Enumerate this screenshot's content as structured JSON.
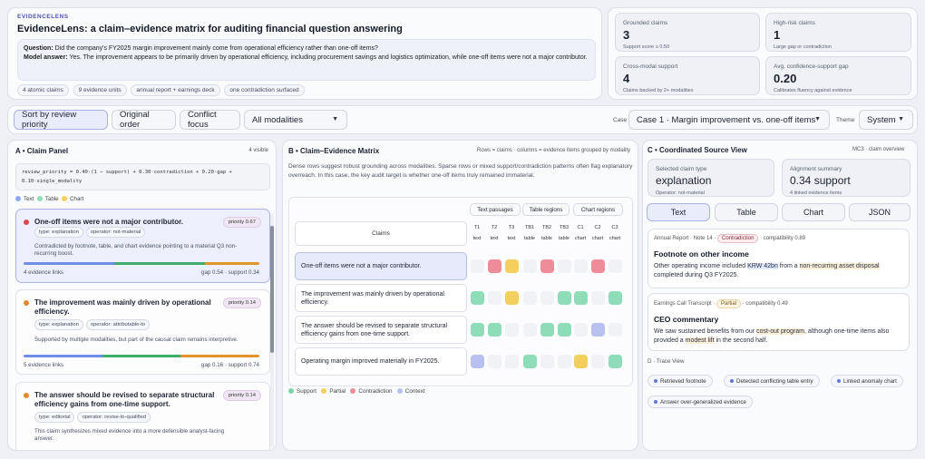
{
  "brand": "EVIDENCELENS",
  "page_title": "EvidenceLens: a claim–evidence matrix for auditing financial question answering",
  "question_label": "Question:",
  "question": "Did the company's FY2025 margin improvement mainly come from operational efficiency rather than one-off items?",
  "answer_label": "Model answer:",
  "answer": "Yes. The improvement appears to be primarily driven by operational efficiency, including procurement savings and logistics optimization, while one-off items were not a major contributor.",
  "summary_pills": [
    "4 atomic claims",
    "9 evidence units",
    "annual report + earnings deck",
    "one contradiction surfaced"
  ],
  "stats": [
    {
      "label": "Grounded claims",
      "value": "3",
      "sub": "Support score ≥ 0.50"
    },
    {
      "label": "High-risk claims",
      "value": "1",
      "sub": "Large gap or contradiction"
    },
    {
      "label": "Cross-modal support",
      "value": "4",
      "sub": "Claims backed by 2+ modalities"
    },
    {
      "label": "Avg. confidence-support gap",
      "value": "0.20",
      "sub": "Calibrates fluency against evidence"
    }
  ],
  "toolbar": {
    "sort_review": "Sort by review priority",
    "original_order": "Original order",
    "conflict_focus": "Conflict focus",
    "modalities": "All modalities",
    "case_label": "Case",
    "case_value": "Case 1 · Margin improvement vs. one-off items",
    "theme_label": "Theme",
    "theme_value": "System"
  },
  "panel_a": {
    "title": "A • Claim Panel",
    "visible": "4 visible",
    "formula_line1": "review_priority = 0.40·(1 − support) + 0.30·contradiction + 0.20·gap +",
    "formula_line2": "0.10·single_modality",
    "legend": [
      "Text",
      "Table",
      "Chart"
    ],
    "claims": [
      {
        "title": "One-off items were not a major contributor.",
        "priority": "priority 0.67",
        "type": "type: explanation",
        "operator": "operator: not-material",
        "desc": "Contradicted by footnote, table, and chart evidence pointing to a material Q3 non-recurring boost.",
        "links": "4 evidence links",
        "metrics": "gap 0.54 · support 0.34"
      },
      {
        "title": "The improvement was mainly driven by operational efficiency.",
        "priority": "priority 0.14",
        "type": "type: explanation",
        "operator": "operator: attributable-to",
        "desc": "Supported by multiple modalities, but part of the causal claim remains interpretive.",
        "links": "5 evidence links",
        "metrics": "gap 0.16 · support 0.74"
      },
      {
        "title": "The answer should be revised to separate structural efficiency gains from one-time support.",
        "priority": "priority 0.14",
        "type": "type: editorial",
        "operator": "operator: revise-to-qualified",
        "desc": "This claim synthesizes mixed evidence into a more defensible analyst-facing answer."
      }
    ]
  },
  "panel_b": {
    "title": "B • Claim–Evidence Matrix",
    "note": "Rows = claims · columns = evidence items grouped by modality",
    "desc": "Dense rows suggest robust grounding across modalities. Sparse rows or mixed support/contradiction patterns often flag explanatory overreach. In this case, the key audit target is whether one-off items truly remained immaterial.",
    "groups": [
      "Text passages",
      "Table regions",
      "Chart regions"
    ],
    "claims_header": "Claims",
    "columns": [
      {
        "id": "T1",
        "kind": "text"
      },
      {
        "id": "T2",
        "kind": "text"
      },
      {
        "id": "T3",
        "kind": "text"
      },
      {
        "id": "TB1",
        "kind": "table"
      },
      {
        "id": "TB2",
        "kind": "table"
      },
      {
        "id": "TB3",
        "kind": "table"
      },
      {
        "id": "C1",
        "kind": "chart"
      },
      {
        "id": "C2",
        "kind": "chart"
      },
      {
        "id": "C3",
        "kind": "chart"
      }
    ],
    "rows": [
      {
        "claim": "One-off items were not a major contributor.",
        "cells": [
          "empty",
          "contradiction",
          "partial",
          "empty",
          "contradiction",
          "empty",
          "empty",
          "contradiction",
          "empty"
        ]
      },
      {
        "claim": "The improvement was mainly driven by operational efficiency.",
        "cells": [
          "support",
          "empty",
          "partial",
          "empty",
          "empty",
          "support",
          "support",
          "empty",
          "support"
        ]
      },
      {
        "claim": "The answer should be revised to separate structural efficiency gains from one-time support.",
        "cells": [
          "support",
          "support",
          "empty",
          "empty",
          "support",
          "support",
          "empty",
          "context",
          "empty"
        ]
      },
      {
        "claim": "Operating margin improved materially in FY2025.",
        "cells": [
          "context",
          "empty",
          "empty",
          "support",
          "empty",
          "empty",
          "partial",
          "empty",
          "support"
        ]
      }
    ],
    "legend": [
      "Support",
      "Partial",
      "Contradiction",
      "Context"
    ],
    "colors": {
      "support": "#8fdcb8",
      "partial": "#f5cf5e",
      "contradiction": "#ee8c9a",
      "context": "#b8c0f0",
      "empty": "#f0f2f6"
    }
  },
  "panel_c": {
    "title": "C • Coordinated Source View",
    "subtitle": "MC3 · claim overview",
    "type_label": "Selected claim type",
    "type_value": "explanation",
    "type_sub": "Operator: not-material",
    "align_label": "Alignment summary",
    "align_value": "0.34 support",
    "align_sub": "4 linked evidence items",
    "tabs": [
      "Text",
      "Table",
      "Chart",
      "JSON"
    ],
    "sources": [
      {
        "meta": "Annual Report · Note 14 ·",
        "badge": "Contradiction",
        "compat": "· compatibility 0.89",
        "heading": "Footnote on other income",
        "pre": "Other operating income included ",
        "hl1": "KRW 42bn",
        "mid": " from a ",
        "hl2": "non-recurring asset disposal",
        "post": " completed during Q3 FY2025."
      },
      {
        "meta": "Earnings Call Transcript ·",
        "badge": "Partial",
        "compat": "· compatibility 0.49",
        "heading": "CEO commentary",
        "pre": "We saw sustained benefits from our ",
        "hl1": "cost-out program",
        "mid": ", although one-time items also provided a ",
        "hl2": "modest lift",
        "post": " in the second half."
      }
    ],
    "trace_title": "D · Trace View",
    "trace": [
      "Retrieved footnote",
      "Detected conflicting table entry",
      "Linked anomaly chart",
      "Answer over-generalized evidence"
    ]
  }
}
